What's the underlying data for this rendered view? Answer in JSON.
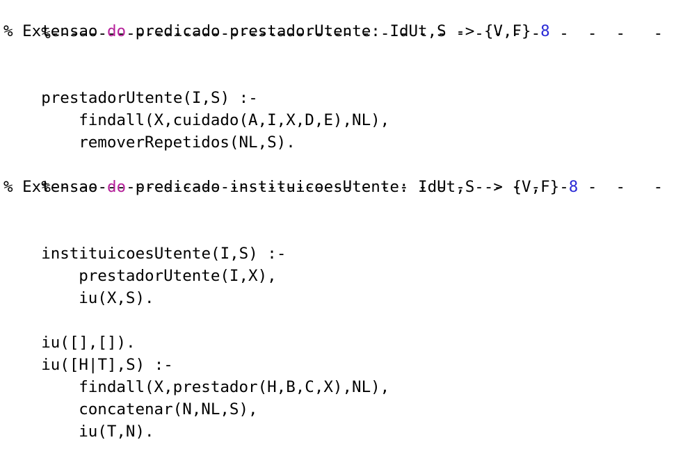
{
  "colors": {
    "background": "#ffffff",
    "text": "#000000",
    "keyword": "#b5219a",
    "number": "#2a2ad6"
  },
  "code": {
    "block1": {
      "separator": "%-------------------------------- - - - - - - - - - -  -  -  -   -",
      "comment_prefix": "% Extensao ",
      "comment_keyword": "do",
      "comment_rest": " predicado prestadorUtente: IdUt,S -> {V,F} ",
      "comment_number": "8",
      "head": "prestadorUtente(I,S) :-",
      "body_1": "findall(X,cuidado(A,I,X,D,E),NL),",
      "body_2": "removerRepetidos(NL,S)."
    },
    "block2": {
      "separator": "%-------------------------------- - - - - - - - - - -  -  -  -   -",
      "comment_prefix": "% Extensao ",
      "comment_keyword": "do",
      "comment_rest": " predicado instituicoesUtente: IdUt,S -> {V,F} ",
      "comment_number": "8",
      "head": "instituicoesUtente(I,S) :-",
      "body_1": "prestadorUtente(I,X),",
      "body_2": "iu(X,S).",
      "iu_base": "iu([],[]).",
      "iu_head": "iu([H|T],S) :-",
      "iu_body_1": "findall(X,prestador(H,B,C,X),NL),",
      "iu_body_2": "concatenar(N,NL,S),",
      "iu_body_3": "iu(T,N)."
    }
  }
}
